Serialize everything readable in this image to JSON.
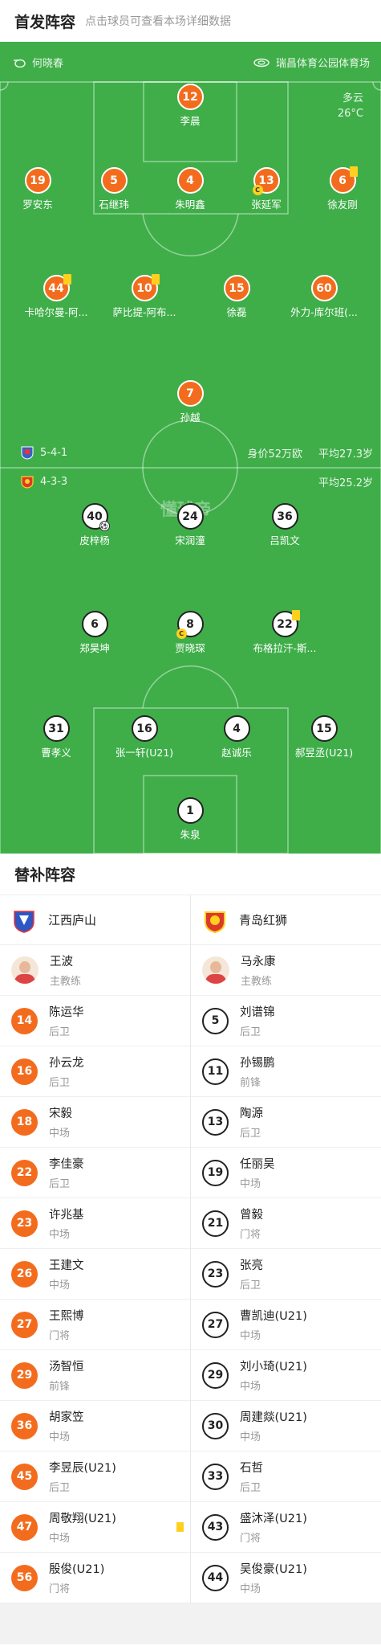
{
  "header": {
    "title": "首发阵容",
    "hint": "点击球员可查看本场详细数据"
  },
  "match": {
    "referee": "何晓春",
    "venue": "瑞昌体育公园体育场",
    "weather": "多云",
    "temperature": "26°C"
  },
  "home_team": {
    "name": "江西庐山",
    "formation": "5-4-1",
    "value": "身价52万欧",
    "avg_age": "平均27.3岁"
  },
  "away_team": {
    "name": "青岛红狮",
    "formation": "4-3-3",
    "avg_age": "平均25.2岁"
  },
  "watermark": "懂球帝",
  "home_players": [
    {
      "number": "12",
      "name": "李晨"
    },
    {
      "number": "19",
      "name": "罗安东"
    },
    {
      "number": "5",
      "name": "石继玮"
    },
    {
      "number": "4",
      "name": "朱明鑫"
    },
    {
      "number": "13",
      "name": "张延军"
    },
    {
      "number": "6",
      "name": "徐友刚"
    },
    {
      "number": "44",
      "name": "卡哈尔曼-阿..."
    },
    {
      "number": "10",
      "name": "萨比提-阿布..."
    },
    {
      "number": "15",
      "name": "徐磊"
    },
    {
      "number": "60",
      "name": "外力-库尔班(..."
    },
    {
      "number": "7",
      "name": "孙越"
    }
  ],
  "away_players": [
    {
      "number": "40",
      "name": "皮梓杨"
    },
    {
      "number": "24",
      "name": "宋润潼"
    },
    {
      "number": "36",
      "name": "吕凯文"
    },
    {
      "number": "6",
      "name": "郑昊坤"
    },
    {
      "number": "8",
      "name": "贾晓琛"
    },
    {
      "number": "22",
      "name": "布格拉汗-斯..."
    },
    {
      "number": "31",
      "name": "曹孝义"
    },
    {
      "number": "16",
      "name": "张一轩(U21)"
    },
    {
      "number": "4",
      "name": "赵诚乐"
    },
    {
      "number": "15",
      "name": "郝昱丞(U21)"
    },
    {
      "number": "1",
      "name": "朱泉"
    }
  ],
  "subs": {
    "title": "替补阵容",
    "home": {
      "team": "江西庐山",
      "coach": {
        "name": "王波",
        "role": "主教练"
      },
      "players": [
        {
          "number": "14",
          "name": "陈运华",
          "pos": "后卫"
        },
        {
          "number": "16",
          "name": "孙云龙",
          "pos": "后卫"
        },
        {
          "number": "18",
          "name": "宋毅",
          "pos": "中场"
        },
        {
          "number": "22",
          "name": "李佳豪",
          "pos": "后卫"
        },
        {
          "number": "23",
          "name": "许兆基",
          "pos": "中场"
        },
        {
          "number": "26",
          "name": "王建文",
          "pos": "中场"
        },
        {
          "number": "27",
          "name": "王熙博",
          "pos": "门将"
        },
        {
          "number": "29",
          "name": "汤智恒",
          "pos": "前锋"
        },
        {
          "number": "36",
          "name": "胡家笠",
          "pos": "中场"
        },
        {
          "number": "45",
          "name": "李昱辰(U21)",
          "pos": "后卫"
        },
        {
          "number": "47",
          "name": "周敬翔(U21)",
          "pos": "中场"
        },
        {
          "number": "56",
          "name": "殷俊(U21)",
          "pos": "门将"
        }
      ]
    },
    "away": {
      "team": "青岛红狮",
      "coach": {
        "name": "马永康",
        "role": "主教练"
      },
      "players": [
        {
          "number": "5",
          "name": "刘谱锦",
          "pos": "后卫"
        },
        {
          "number": "11",
          "name": "孙锡鹏",
          "pos": "前锋"
        },
        {
          "number": "13",
          "name": "陶源",
          "pos": "后卫"
        },
        {
          "number": "19",
          "name": "任丽昊",
          "pos": "中场"
        },
        {
          "number": "21",
          "name": "曾毅",
          "pos": "门将"
        },
        {
          "number": "23",
          "name": "张亮",
          "pos": "后卫"
        },
        {
          "number": "27",
          "name": "曹凯迪(U21)",
          "pos": "中场"
        },
        {
          "number": "29",
          "name": "刘小琦(U21)",
          "pos": "中场"
        },
        {
          "number": "30",
          "name": "周建燚(U21)",
          "pos": "中场"
        },
        {
          "number": "33",
          "name": "石哲",
          "pos": "后卫"
        },
        {
          "number": "43",
          "name": "盛沐泽(U21)",
          "pos": "门将"
        },
        {
          "number": "44",
          "name": "吴俊豪(U21)",
          "pos": "中场"
        }
      ]
    }
  },
  "colors": {
    "pitch": "#3fae49",
    "home": "#f36c1e",
    "yellow_card": "#ffd01e"
  }
}
